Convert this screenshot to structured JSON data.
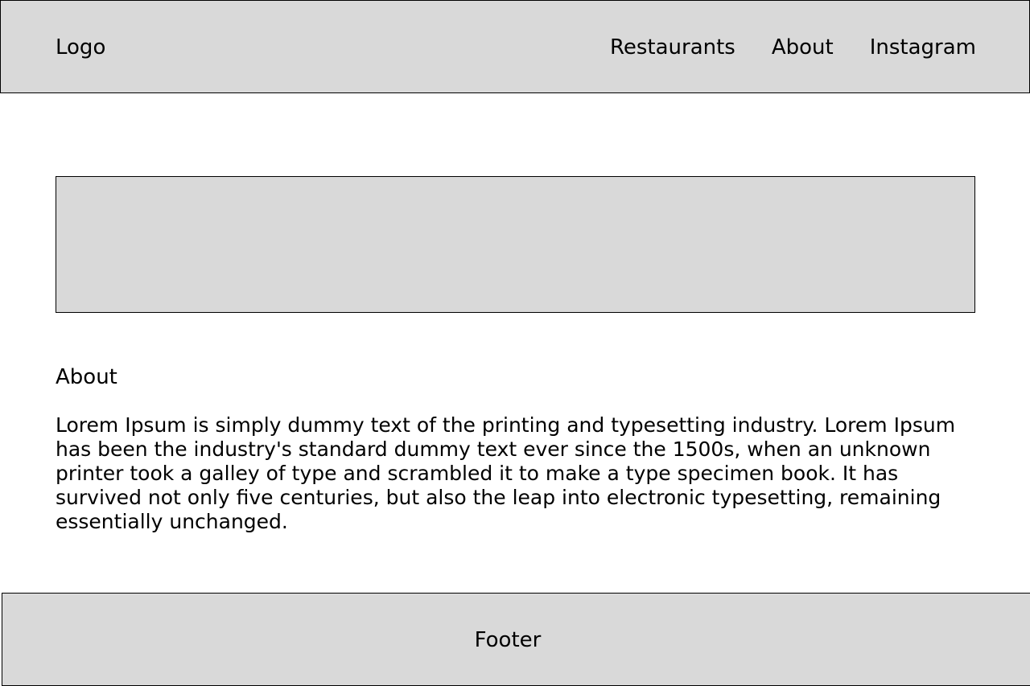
{
  "header": {
    "logo": "Logo",
    "nav": [
      "Restaurants",
      "About",
      "Instagram"
    ]
  },
  "about": {
    "heading": "About",
    "body": "Lorem Ipsum is simply dummy text of the printing and typesetting industry. Lorem Ipsum has been the industry's standard dummy text ever since the 1500s, when an unknown printer took a galley of type and scrambled it to make a type specimen book. It has survived not only five centuries, but also the leap into electronic typesetting, remaining essentially unchanged."
  },
  "footer": {
    "label": "Footer"
  },
  "colors": {
    "panel": "#d9d9d9",
    "border": "#000000",
    "text": "#000000",
    "background": "#ffffff"
  }
}
